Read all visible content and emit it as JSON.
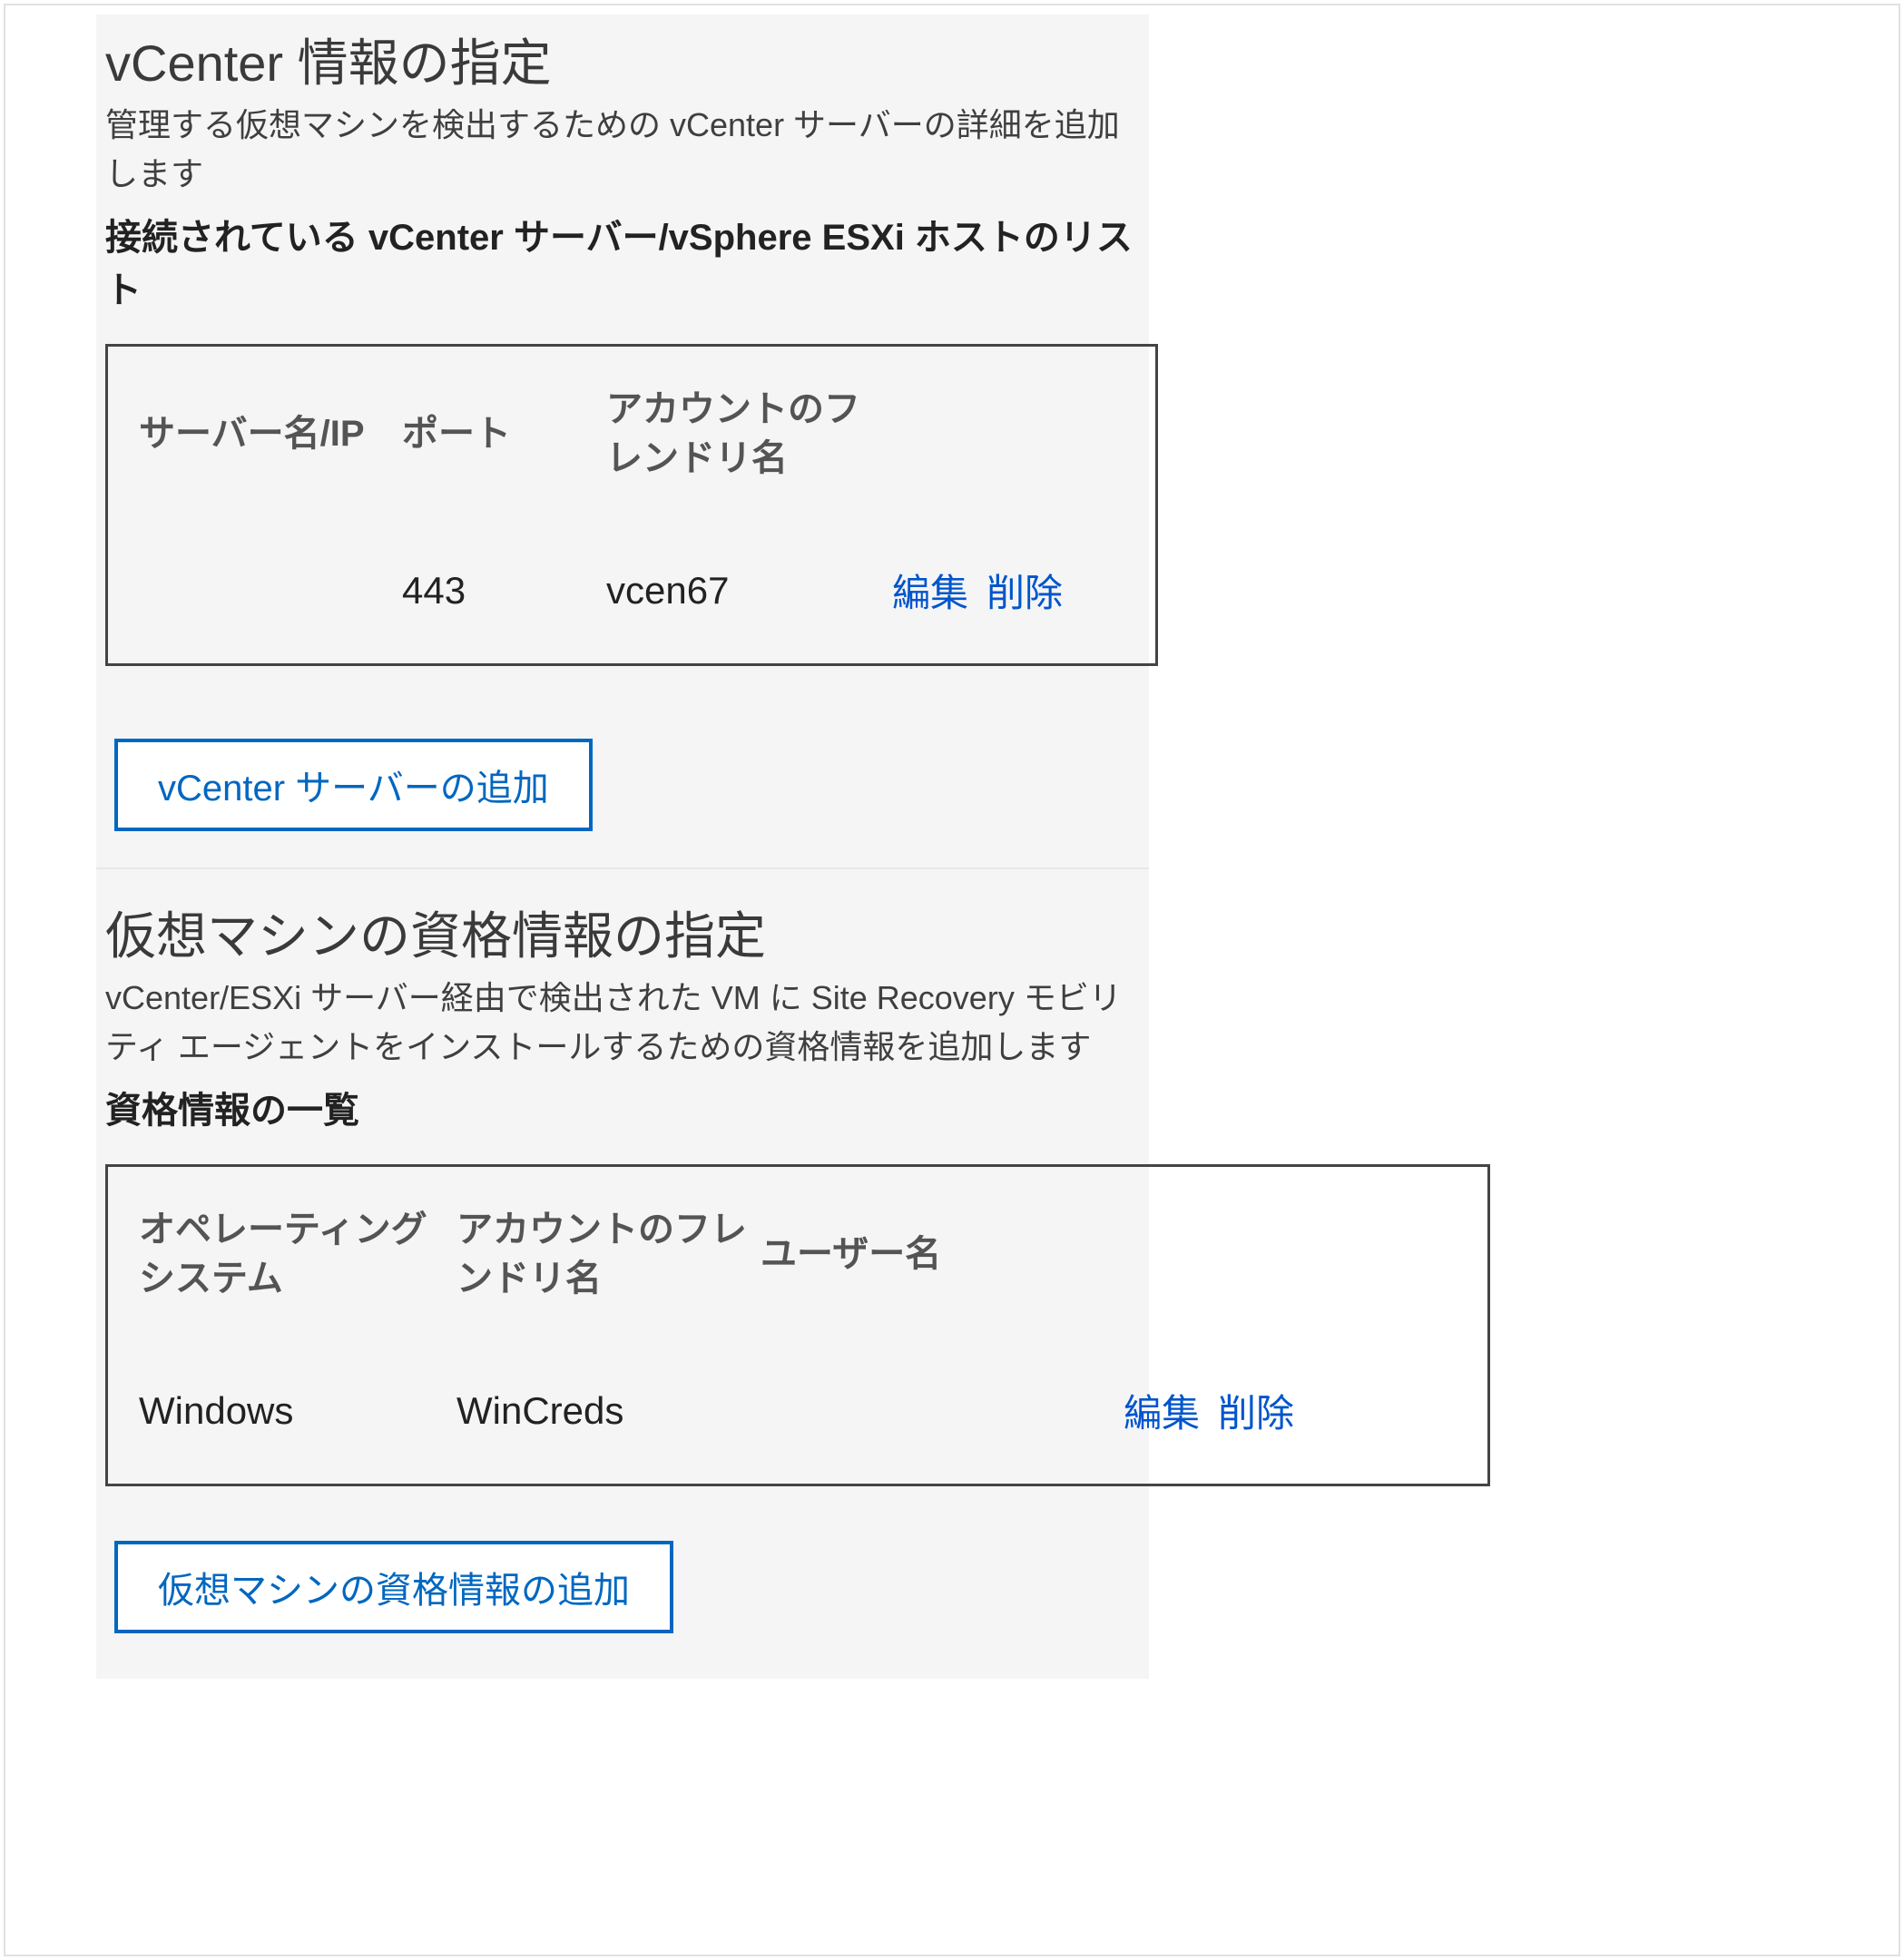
{
  "section1": {
    "title": "vCenter 情報の指定",
    "description": "管理する仮想マシンを検出するための vCenter サーバーの詳細を追加します",
    "subtitle": "接続されている vCenter サーバー/vSphere ESXi ホストのリスト",
    "table": {
      "headers": {
        "col1": "サーバー名/IP",
        "col2": "ポート",
        "col3": "アカウントのフレンドリ名"
      },
      "row": {
        "col1": "",
        "col2": "443",
        "col3": "vcen67",
        "edit": "編集",
        "delete": "削除"
      }
    },
    "button": "vCenter サーバーの追加"
  },
  "section2": {
    "title": "仮想マシンの資格情報の指定",
    "description": "vCenter/ESXi サーバー経由で検出された VM に Site Recovery モビリティ エージェントをインストールするための資格情報を追加します",
    "subtitle": "資格情報の一覧",
    "table": {
      "headers": {
        "col1": "オペレーティング システム",
        "col2": "アカウントのフレンドリ名",
        "col3": "ユーザー名"
      },
      "row": {
        "col1": "Windows",
        "col2": "WinCreds",
        "col3": "",
        "edit": "編集",
        "delete": "削除"
      }
    },
    "button": "仮想マシンの資格情報の追加"
  }
}
